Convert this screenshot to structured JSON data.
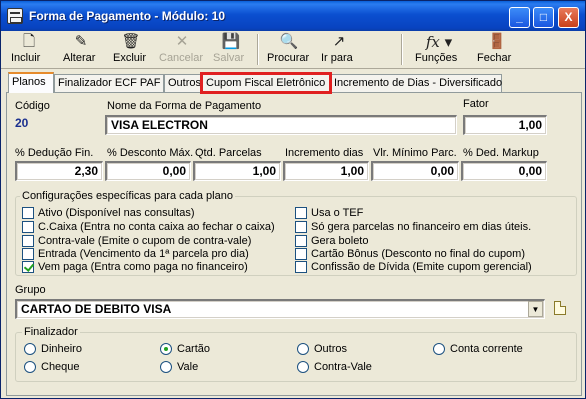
{
  "window": {
    "title": "Forma de Pagamento - Módulo: 10",
    "min_label": "_",
    "max_label": "□",
    "close_label": "X"
  },
  "toolbar": {
    "incluir": "Incluir",
    "alterar": "Alterar",
    "excluir": "Excluir",
    "cancelar": "Cancelar",
    "salvar": "Salvar",
    "procurar": "Procurar",
    "ir_para": "Ir para",
    "funcoes": "Funções",
    "fechar": "Fechar"
  },
  "tabs": [
    {
      "label": "Planos"
    },
    {
      "label": "Finalizador ECF PAF"
    },
    {
      "label": "Outros"
    },
    {
      "label": "Cupom Fiscal Eletrônico"
    },
    {
      "label": "Incremento de Dias - Diversificado"
    }
  ],
  "form": {
    "codigo_label": "Código",
    "codigo_value": "20",
    "nome_label": "Nome da Forma de Pagamento",
    "nome_value": "VISA ELECTRON",
    "fator_label": "Fator",
    "fator_value": "1,00",
    "deducao_label": "% Dedução Fin.",
    "deducao_value": "2,30",
    "desconto_label": "% Desconto Máx.",
    "desconto_value": "0,00",
    "parcelas_label": "Qtd. Parcelas",
    "parcelas_value": "1,00",
    "incremento_label": "Incremento dias",
    "incremento_value": "1,00",
    "vlmin_label": "Vlr. Mínimo Parc.",
    "vlmin_value": "0,00",
    "markup_label": "% Ded. Markup",
    "markup_value": "0,00"
  },
  "config": {
    "title": "Configurações específicas para cada plano",
    "left": [
      {
        "label": "Ativo (Disponível nas consultas)",
        "checked": false
      },
      {
        "label": "C.Caixa (Entra no conta caixa ao fechar o caixa)",
        "checked": false
      },
      {
        "label": "Contra-vale (Emite o cupom de contra-vale)",
        "checked": false
      },
      {
        "label": "Entrada (Vencimento da 1ª parcela pro dia)",
        "checked": false
      },
      {
        "label": "Vem paga (Entra como paga no financeiro)",
        "checked": true
      }
    ],
    "right": [
      {
        "label": "Usa o TEF",
        "checked": false
      },
      {
        "label": "Só gera parcelas no financeiro em dias úteis.",
        "checked": false
      },
      {
        "label": "Gera boleto",
        "checked": false
      },
      {
        "label": "Cartão Bônus (Desconto no final do cupom)",
        "checked": false
      },
      {
        "label": "Confissão de Dívida (Emite cupom gerencial)",
        "checked": false
      }
    ]
  },
  "grupo": {
    "label": "Grupo",
    "value": "CARTAO DE DEBITO VISA"
  },
  "finalizador": {
    "title": "Finalizador",
    "options": [
      {
        "label": "Dinheiro",
        "selected": false
      },
      {
        "label": "Cartão",
        "selected": true
      },
      {
        "label": "Outros",
        "selected": false
      },
      {
        "label": "Conta corrente",
        "selected": false
      },
      {
        "label": "Cheque",
        "selected": false
      },
      {
        "label": "Vale",
        "selected": false
      },
      {
        "label": "Contra-Vale",
        "selected": false
      }
    ]
  }
}
